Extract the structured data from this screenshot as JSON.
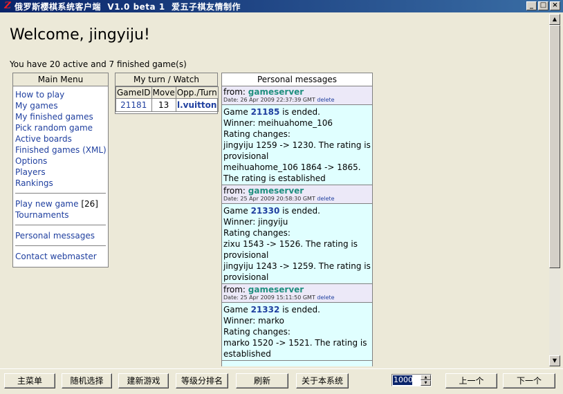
{
  "window": {
    "title": "俄罗斯樱棋系统客户端  V1.0 beta 1  爱五子棋友情制作",
    "icon_name": "app-logo-icon",
    "controls": [
      "minimize",
      "maximize",
      "close"
    ],
    "control_glyphs": {
      "minimize": "_",
      "maximize": "□",
      "close": "×"
    }
  },
  "page": {
    "welcome": "Welcome, jingyiju!",
    "summary": "You have 20 active and 7 finished game(s)"
  },
  "menu": {
    "title": "Main Menu",
    "groups": [
      [
        "How to play",
        "My games",
        "My finished games",
        "Pick random game",
        "Active boards",
        "Finished games (XML)",
        "Options",
        "Players",
        "Rankings"
      ],
      [
        "Play new game",
        "Tournaments"
      ],
      [
        "Personal messages"
      ],
      [
        "Contact webmaster"
      ]
    ],
    "new_game_count": "[26]"
  },
  "myturn": {
    "title": "My turn / Watch",
    "columns": [
      "GameID",
      "Move",
      "Opp./Turn"
    ],
    "rows": [
      {
        "game_id": "21181",
        "move": "13",
        "opp": "l.vuitton"
      }
    ]
  },
  "messages": {
    "title": "Personal messages",
    "delete_label": "delete",
    "items": [
      {
        "from_label": "from:",
        "sender": "gameserver",
        "date": "Date: 26 Apr 2009 22:37:39 GMT",
        "body_pre": "Game",
        "game_id": "21185",
        "body_post": "is ended.",
        "winner": "Winner: meihuahome_106",
        "rating_label": "Rating changes:",
        "line1": "jingyiju 1259 -> 1230. The rating is provisional",
        "line2": "meihuahome_106 1864 -> 1865. The rating is established"
      },
      {
        "from_label": "from:",
        "sender": "gameserver",
        "date": "Date: 25 Apr 2009 20:58:30 GMT",
        "body_pre": "Game",
        "game_id": "21330",
        "body_post": "is ended.",
        "winner": "Winner: jingyiju",
        "rating_label": "Rating changes:",
        "line1": "zixu 1543 -> 1526. The rating is provisional",
        "line2": "jingyiju 1243 -> 1259. The rating is provisional"
      },
      {
        "from_label": "from:",
        "sender": "gameserver",
        "date": "Date: 25 Apr 2009 15:11:50 GMT",
        "body_pre": "Game",
        "game_id": "21332",
        "body_post": "is ended.",
        "winner": "Winner: marko",
        "rating_label": "Rating changes:",
        "line1": "marko 1520 -> 1521. The rating is established",
        "line2": ""
      }
    ]
  },
  "scrollbar": {
    "up_icon": "▲",
    "down_icon": "▼"
  },
  "toolbar": {
    "buttons": [
      "主菜单",
      "随机选择",
      "建新游戏",
      "等级分排名",
      "刷新",
      "关于本系统",
      "上一个",
      "下一个"
    ],
    "spin_value": "1000",
    "spin_up": "▲",
    "spin_down": "▼"
  }
}
